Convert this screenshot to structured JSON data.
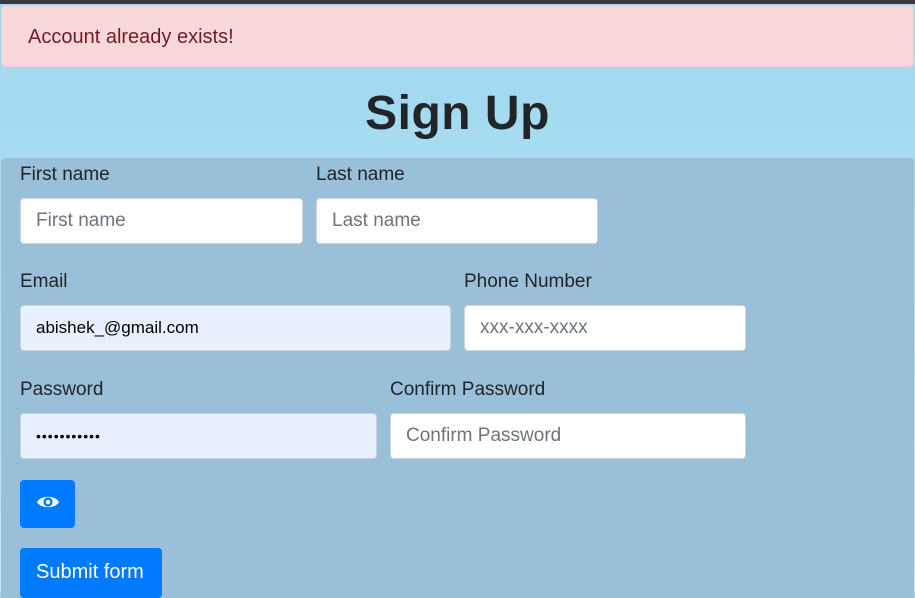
{
  "alert": {
    "message": "Account already exists!"
  },
  "page": {
    "title": "Sign Up"
  },
  "form": {
    "first_name": {
      "label": "First name",
      "placeholder": "First name",
      "value": ""
    },
    "last_name": {
      "label": "Last name",
      "placeholder": "Last name",
      "value": ""
    },
    "email": {
      "label": "Email",
      "value": "abishek_@gmail.com"
    },
    "phone": {
      "label": "Phone Number",
      "placeholder": "xxx-xxx-xxxx",
      "value": ""
    },
    "password": {
      "label": "Password",
      "value": "•••••••••••"
    },
    "confirm_password": {
      "label": "Confirm Password",
      "placeholder": "Confirm Password",
      "value": ""
    },
    "toggle_visibility": {
      "icon": "eye-icon"
    },
    "submit": {
      "label": "Submit form"
    }
  },
  "colors": {
    "alert_bg": "#f8d7da",
    "alert_text": "#721c24",
    "primary": "#007bff",
    "panel_bg": "#99c0d8",
    "autofill_bg": "#e8f0fe"
  }
}
